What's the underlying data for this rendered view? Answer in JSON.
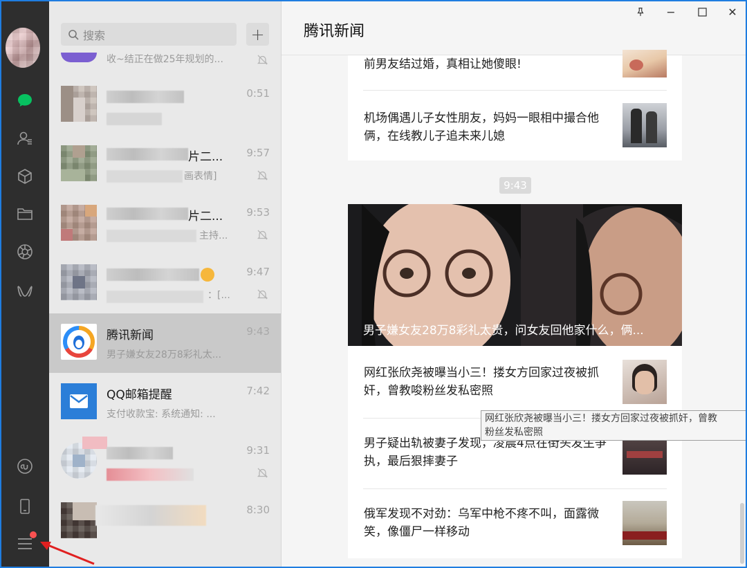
{
  "search": {
    "placeholder": "搜索"
  },
  "chats": [
    {
      "name": "",
      "preview": "收~结正在做25年规划的...",
      "time": ""
    },
    {
      "name": "",
      "preview": "",
      "time": "0:51"
    },
    {
      "name": "片二...",
      "preview": "画表情]",
      "time": "9:57"
    },
    {
      "name": "片二...",
      "preview": "主持...",
      "time": "9:53"
    },
    {
      "name": "",
      "preview": "：[...",
      "time": "9:47"
    },
    {
      "name": "腾讯新闻",
      "preview": "男子嫌女友28万8彩礼太...",
      "time": "9:43"
    },
    {
      "name": "QQ邮箱提醒",
      "preview": "支付收款宝: 系统通知: ...",
      "time": "7:42"
    },
    {
      "name": "",
      "preview": "",
      "time": "9:31"
    },
    {
      "name": "",
      "preview": "",
      "time": "8:30"
    }
  ],
  "chat": {
    "title": "腾讯新闻",
    "timestamp": "9:43",
    "news_top": [
      {
        "text": "前男友结过婚，真相让她傻眼!"
      },
      {
        "text": "机场偶遇儿子女性朋友，妈妈一眼相中撮合他俩，在线教儿子追未来儿媳"
      }
    ],
    "hero_caption": "男子嫌女友28万8彩礼太贵，问女友回他家什么，俩...",
    "news_bottom": [
      {
        "text": "网红张欣尧被曝当小三！搂女方回家过夜被抓奸，曾教唆粉丝发私密照"
      },
      {
        "text": "男子疑出轨被妻子发现，凌晨4点在街头发生争执，最后狠摔妻子"
      },
      {
        "text": "俄军发现不对劲：乌军中枪不疼不叫，面露微笑，像僵尸一样移动"
      }
    ]
  },
  "tooltip": {
    "line1": "网红张欣尧被曝当小三！搂女方回家过夜被抓奸，曾教",
    "line2": "粉丝发私密照"
  },
  "window": {
    "pin": "⊥",
    "minimize": "−",
    "maximize": "☐",
    "close": "✕"
  },
  "colors": {
    "accent": "#07c160",
    "rail": "#2e2e2e",
    "active_item": "#c9c9c9",
    "badge": "#fa5151"
  }
}
